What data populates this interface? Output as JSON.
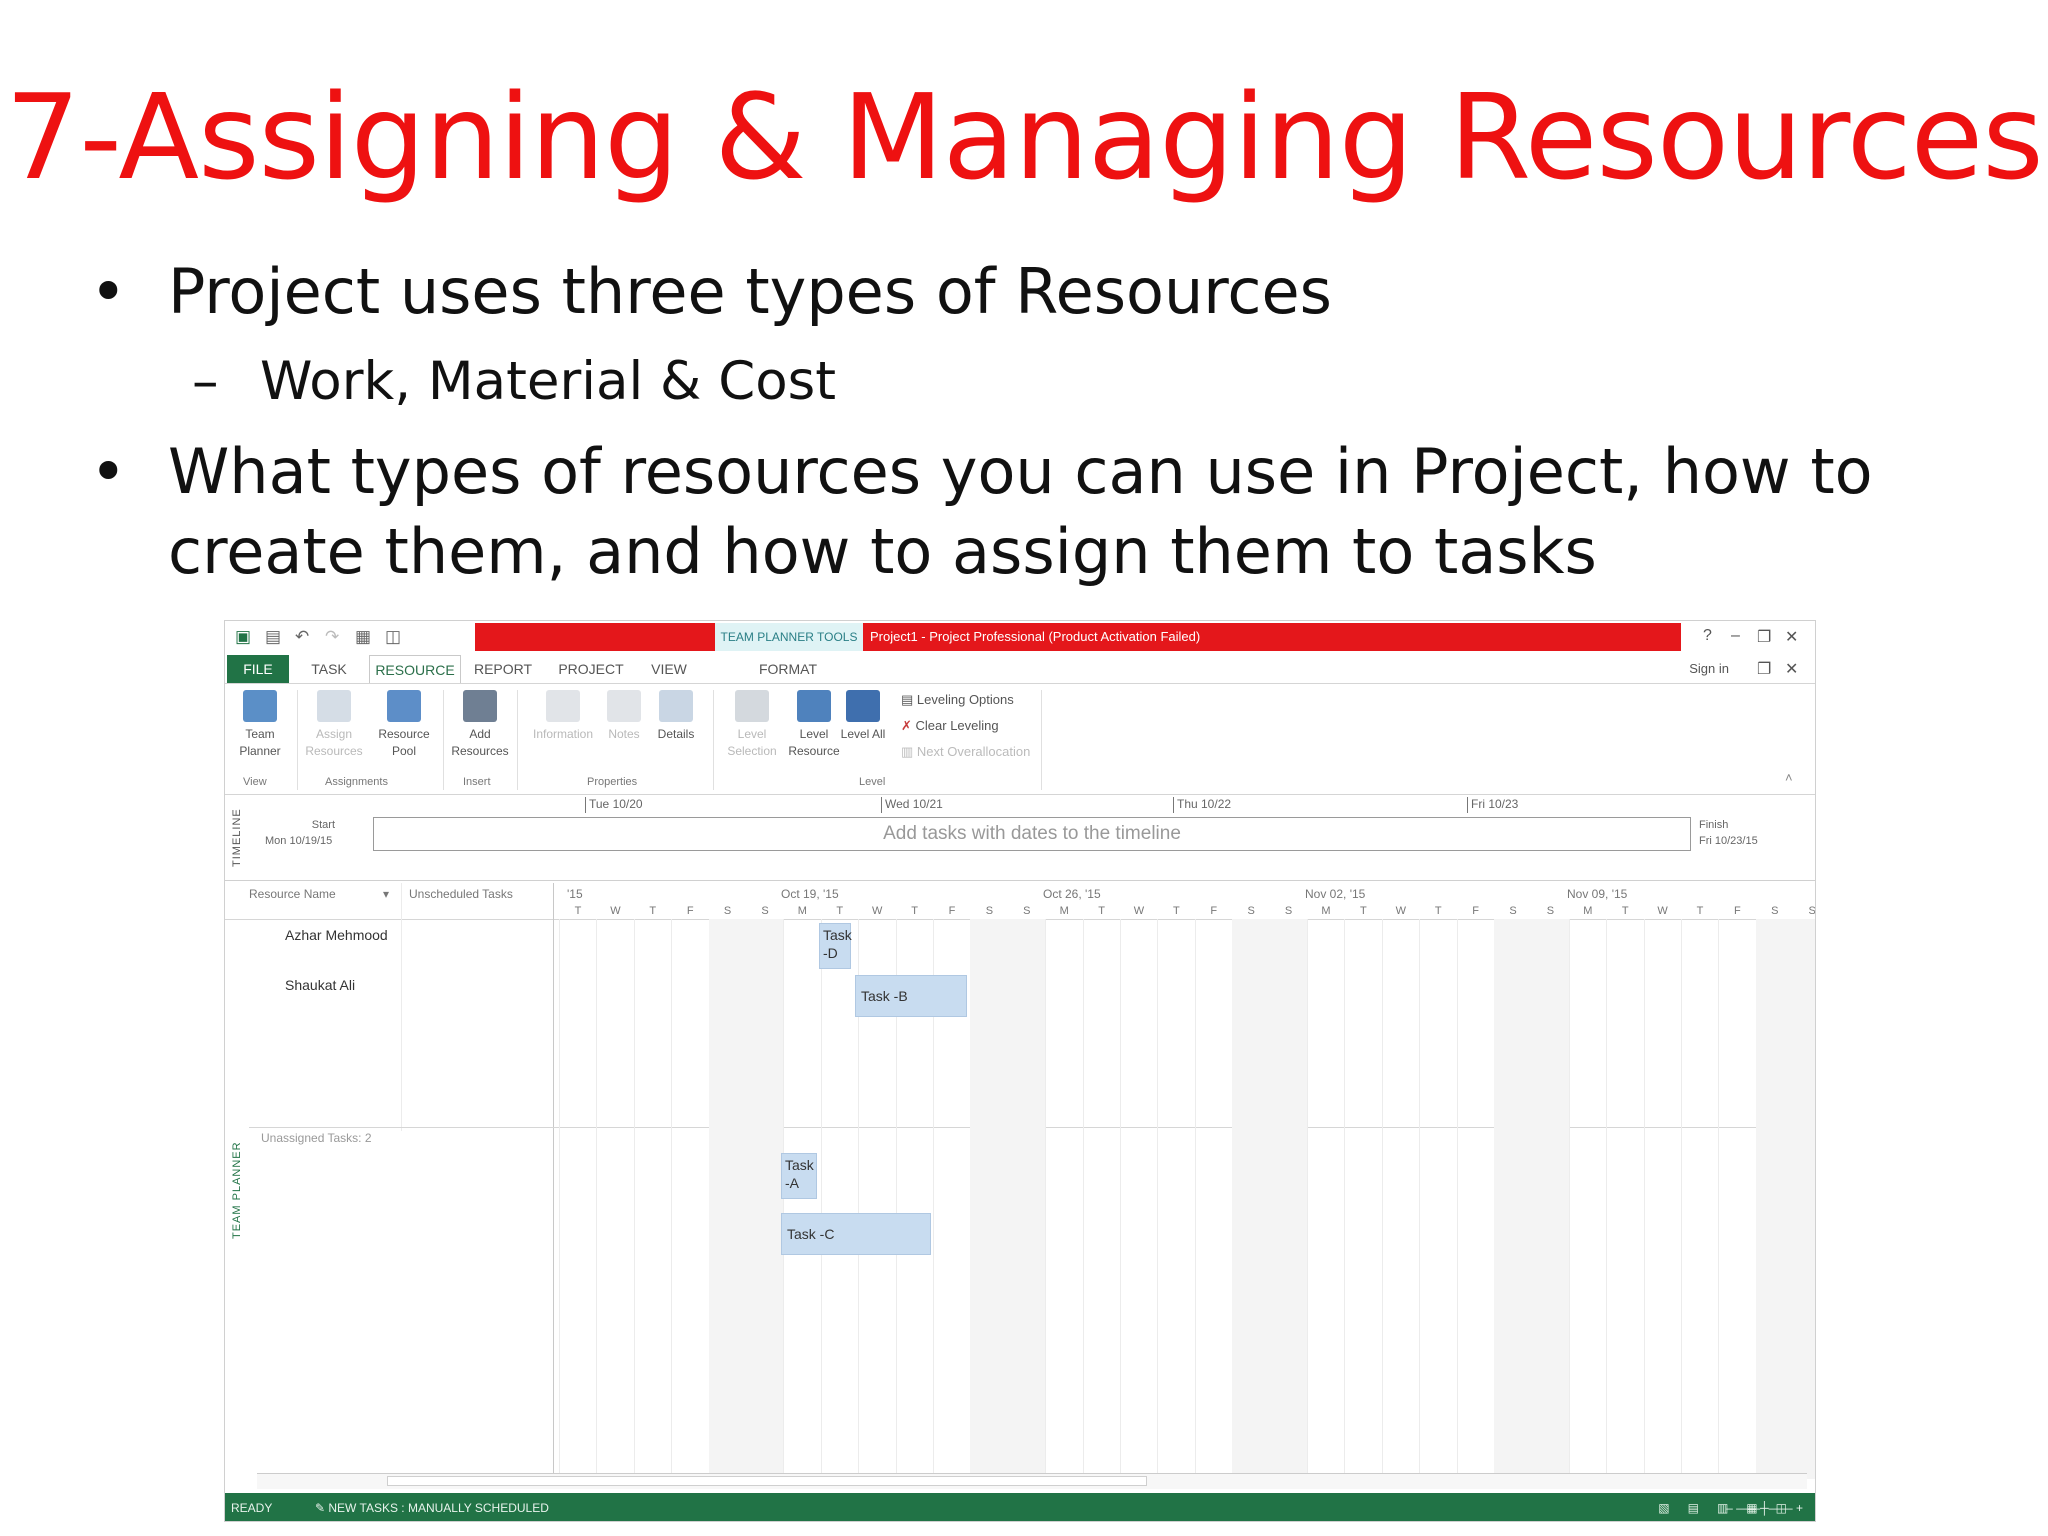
{
  "slide": {
    "title": "7-Assigning & Managing Resources",
    "bullets": [
      {
        "text": "Project uses three types of Resources"
      },
      {
        "text": "What types of resources you can use in Project, how to create them, and how to assign them to tasks"
      }
    ],
    "sub_bullet": "Work, Material & Cost",
    "bullet_char": "•",
    "dash_char": "–"
  },
  "app": {
    "context_tab": "TEAM PLANNER TOOLS",
    "window_title": "Project1 - Project Professional (Product Activation Failed)",
    "tabs": [
      "FILE",
      "TASK",
      "RESOURCE",
      "REPORT",
      "PROJECT",
      "VIEW",
      "FORMAT"
    ],
    "active_tab": "RESOURCE",
    "sign_in": "Sign in",
    "ribbon": {
      "team_planner": "Team Planner",
      "assign_resources": "Assign Resources",
      "resource_pool": "Resource Pool",
      "add_resources": "Add Resources",
      "information": "Information",
      "notes": "Notes",
      "details": "Details",
      "level_selection": "Level Selection",
      "level_resource": "Level Resource",
      "level_all": "Level All",
      "leveling_options": "Leveling Options",
      "clear_leveling": "Clear Leveling",
      "next_overallocation": "Next Overallocation",
      "groups": {
        "view": "View",
        "assignments": "Assignments",
        "insert": "Insert",
        "properties": "Properties",
        "level": "Level"
      }
    },
    "timeline": {
      "side_label": "TIMELINE",
      "start_label": "Start",
      "start_date": "Mon 10/19/15",
      "finish_label": "Finish",
      "finish_date": "Fri 10/23/15",
      "placeholder": "Add tasks with dates to the timeline",
      "dates": [
        "Tue 10/20",
        "Wed 10/21",
        "Thu 10/22",
        "Fri 10/23"
      ]
    },
    "planner": {
      "side_label": "TEAM PLANNER",
      "col_resource": "Resource Name",
      "col_unscheduled": "Unscheduled Tasks",
      "weeks": [
        "'15",
        "Oct 19, '15",
        "Oct 26, '15",
        "Nov 02, '15",
        "Nov 09, '15"
      ],
      "days": [
        "T",
        "W",
        "T",
        "F",
        "S",
        "S",
        "M",
        "T",
        "W",
        "T",
        "F",
        "S",
        "S",
        "M",
        "T",
        "W",
        "T",
        "F",
        "S",
        "S",
        "M",
        "T",
        "W",
        "T",
        "F",
        "S",
        "S",
        "M",
        "T",
        "W",
        "T",
        "F",
        "S",
        "S"
      ],
      "resources": [
        "Azhar Mehmood",
        "Shaukat Ali"
      ],
      "unassigned_label": "Unassigned Tasks: 2",
      "tasks": {
        "d": "Task -D",
        "b": "Task -B",
        "a": "Task -A",
        "c": "Task -C"
      }
    },
    "status": {
      "ready": "READY",
      "new_tasks": "NEW TASKS : MANUALLY SCHEDULED"
    }
  }
}
